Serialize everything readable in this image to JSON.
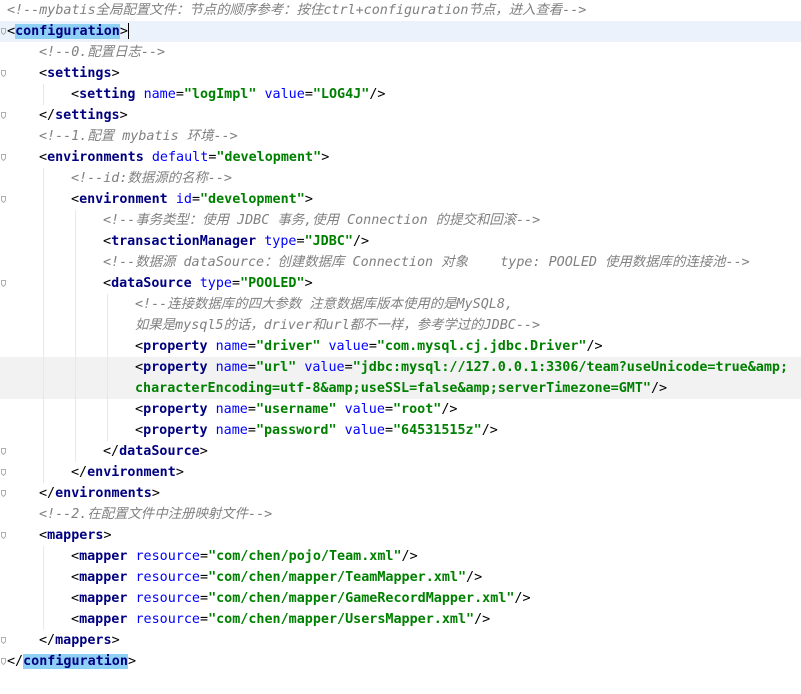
{
  "editor": {
    "lines": [
      {
        "indent": 0,
        "tokens": [
          [
            "c",
            "<!--mybatis全局配置文件：节点的顺序参考：按住ctrl+configuration节点，进入查看-->"
          ]
        ]
      },
      {
        "indent": 0,
        "tokens": [
          [
            "p",
            "<"
          ],
          [
            "t",
            "configuration"
          ],
          [
            "p",
            ">"
          ]
        ],
        "selected": true,
        "caret": true
      },
      {
        "indent": 1,
        "tokens": [
          [
            "c",
            "<!--0.配置日志-->"
          ]
        ]
      },
      {
        "indent": 1,
        "tokens": [
          [
            "p",
            "<"
          ],
          [
            "t",
            "settings"
          ],
          [
            "p",
            ">"
          ]
        ]
      },
      {
        "indent": 2,
        "tokens": [
          [
            "p",
            "<"
          ],
          [
            "t",
            "setting "
          ],
          [
            "a",
            "name"
          ],
          [
            "p",
            "="
          ],
          [
            "v",
            "\"logImpl\""
          ],
          [
            "p",
            " "
          ],
          [
            "a",
            "value"
          ],
          [
            "p",
            "="
          ],
          [
            "v",
            "\"LOG4J\""
          ],
          [
            "p",
            "/>"
          ]
        ]
      },
      {
        "indent": 1,
        "tokens": [
          [
            "p",
            "</"
          ],
          [
            "t",
            "settings"
          ],
          [
            "p",
            ">"
          ]
        ]
      },
      {
        "indent": 1,
        "tokens": [
          [
            "c",
            "<!--1.配置 mybatis 环境-->"
          ]
        ]
      },
      {
        "indent": 1,
        "tokens": [
          [
            "p",
            "<"
          ],
          [
            "t",
            "environments "
          ],
          [
            "a",
            "default"
          ],
          [
            "p",
            "="
          ],
          [
            "v",
            "\"development\""
          ],
          [
            "p",
            ">"
          ]
        ]
      },
      {
        "indent": 2,
        "tokens": [
          [
            "c",
            "<!--id:数据源的名称-->"
          ]
        ]
      },
      {
        "indent": 2,
        "tokens": [
          [
            "p",
            "<"
          ],
          [
            "t",
            "environment "
          ],
          [
            "a",
            "id"
          ],
          [
            "p",
            "="
          ],
          [
            "v",
            "\"development\""
          ],
          [
            "p",
            ">"
          ]
        ]
      },
      {
        "indent": 3,
        "tokens": [
          [
            "c",
            "<!--事务类型：使用 JDBC 事务,使用 Connection 的提交和回滚-->"
          ]
        ]
      },
      {
        "indent": 3,
        "tokens": [
          [
            "p",
            "<"
          ],
          [
            "t",
            "transactionManager "
          ],
          [
            "a",
            "type"
          ],
          [
            "p",
            "="
          ],
          [
            "v",
            "\"JDBC\""
          ],
          [
            "p",
            "/>"
          ]
        ]
      },
      {
        "indent": 3,
        "tokens": [
          [
            "c",
            "<!--数据源 dataSource：创建数据库 Connection 对象    type: POOLED 使用数据库的连接池-->"
          ]
        ]
      },
      {
        "indent": 3,
        "tokens": [
          [
            "p",
            "<"
          ],
          [
            "t",
            "dataSource "
          ],
          [
            "a",
            "type"
          ],
          [
            "p",
            "="
          ],
          [
            "v",
            "\"POOLED\""
          ],
          [
            "p",
            ">"
          ]
        ]
      },
      {
        "indent": 4,
        "tokens": [
          [
            "c",
            "<!--连接数据库的四大参数 注意数据库版本使用的是MySQL8,"
          ]
        ]
      },
      {
        "indent": 4,
        "tokens": [
          [
            "c",
            "如果是mysql5的话，driver和url都不一样，参考学过的JDBC-->"
          ]
        ]
      },
      {
        "indent": 4,
        "tokens": [
          [
            "p",
            "<"
          ],
          [
            "t",
            "property "
          ],
          [
            "a",
            "name"
          ],
          [
            "p",
            "="
          ],
          [
            "v",
            "\"driver\""
          ],
          [
            "p",
            " "
          ],
          [
            "a",
            "value"
          ],
          [
            "p",
            "="
          ],
          [
            "v",
            "\"com.mysql.cj.jdbc.Driver\""
          ],
          [
            "p",
            "/>"
          ]
        ]
      },
      {
        "indent": 4,
        "tokens": [
          [
            "p",
            "<"
          ],
          [
            "t",
            "property "
          ],
          [
            "a",
            "name"
          ],
          [
            "p",
            "="
          ],
          [
            "v",
            "\"url\""
          ],
          [
            "p",
            " "
          ],
          [
            "a",
            "value"
          ],
          [
            "p",
            "="
          ],
          [
            "v",
            "\"jdbc:mysql://127.0.0.1:3306/team?useUnicode=true&amp;"
          ]
        ],
        "gray": true
      },
      {
        "indent": 4,
        "tokens": [
          [
            "v",
            "characterEncoding=utf-8&amp;useSSL=false&amp;serverTimezone=GMT\""
          ],
          [
            "p",
            "/>"
          ]
        ],
        "gray": true
      },
      {
        "indent": 4,
        "tokens": [
          [
            "p",
            "<"
          ],
          [
            "t",
            "property "
          ],
          [
            "a",
            "name"
          ],
          [
            "p",
            "="
          ],
          [
            "v",
            "\"username\""
          ],
          [
            "p",
            " "
          ],
          [
            "a",
            "value"
          ],
          [
            "p",
            "="
          ],
          [
            "v",
            "\"root\""
          ],
          [
            "p",
            "/>"
          ]
        ]
      },
      {
        "indent": 4,
        "tokens": [
          [
            "p",
            "<"
          ],
          [
            "t",
            "property "
          ],
          [
            "a",
            "name"
          ],
          [
            "p",
            "="
          ],
          [
            "v",
            "\"password\""
          ],
          [
            "p",
            " "
          ],
          [
            "a",
            "value"
          ],
          [
            "p",
            "="
          ],
          [
            "v",
            "\"64531515z\""
          ],
          [
            "p",
            "/>"
          ]
        ]
      },
      {
        "indent": 3,
        "tokens": [
          [
            "p",
            "</"
          ],
          [
            "t",
            "dataSource"
          ],
          [
            "p",
            ">"
          ]
        ]
      },
      {
        "indent": 2,
        "tokens": [
          [
            "p",
            "</"
          ],
          [
            "t",
            "environment"
          ],
          [
            "p",
            ">"
          ]
        ]
      },
      {
        "indent": 1,
        "tokens": [
          [
            "p",
            "</"
          ],
          [
            "t",
            "environments"
          ],
          [
            "p",
            ">"
          ]
        ]
      },
      {
        "indent": 1,
        "tokens": [
          [
            "c",
            "<!--2.在配置文件中注册映射文件-->"
          ]
        ]
      },
      {
        "indent": 1,
        "tokens": [
          [
            "p",
            "<"
          ],
          [
            "t",
            "mappers"
          ],
          [
            "p",
            ">"
          ]
        ]
      },
      {
        "indent": 2,
        "tokens": [
          [
            "p",
            "<"
          ],
          [
            "t",
            "mapper "
          ],
          [
            "a",
            "resource"
          ],
          [
            "p",
            "="
          ],
          [
            "v",
            "\"com/chen/pojo/Team.xml\""
          ],
          [
            "p",
            "/>"
          ]
        ]
      },
      {
        "indent": 2,
        "tokens": [
          [
            "p",
            "<"
          ],
          [
            "t",
            "mapper "
          ],
          [
            "a",
            "resource"
          ],
          [
            "p",
            "="
          ],
          [
            "v",
            "\"com/chen/mapper/TeamMapper.xml\""
          ],
          [
            "p",
            "/>"
          ]
        ]
      },
      {
        "indent": 2,
        "tokens": [
          [
            "p",
            "<"
          ],
          [
            "t",
            "mapper "
          ],
          [
            "a",
            "resource"
          ],
          [
            "p",
            "="
          ],
          [
            "v",
            "\"com/chen/mapper/GameRecordMapper.xml\""
          ],
          [
            "p",
            "/>"
          ]
        ]
      },
      {
        "indent": 2,
        "tokens": [
          [
            "p",
            "<"
          ],
          [
            "t",
            "mapper "
          ],
          [
            "a",
            "resource"
          ],
          [
            "p",
            "="
          ],
          [
            "v",
            "\"com/chen/mapper/UsersMapper.xml\""
          ],
          [
            "p",
            "/>"
          ]
        ]
      },
      {
        "indent": 1,
        "tokens": [
          [
            "p",
            "</"
          ],
          [
            "t",
            "mappers"
          ],
          [
            "p",
            ">"
          ]
        ]
      },
      {
        "indent": 0,
        "tokens": [
          [
            "p",
            "</"
          ],
          [
            "t",
            "configuration"
          ],
          [
            "p",
            ">"
          ]
        ],
        "selected": true
      }
    ],
    "fold_markers": [
      1,
      3,
      5,
      7,
      9,
      13,
      21,
      22,
      23,
      25,
      30,
      31
    ],
    "colors": {
      "comment": "#808080",
      "tag": "#000080",
      "attr": "#0000ff",
      "value": "#008000",
      "selection": "#8fd0f5",
      "current_line": "#ecf2fb",
      "guide": "#e8e8e8"
    }
  }
}
